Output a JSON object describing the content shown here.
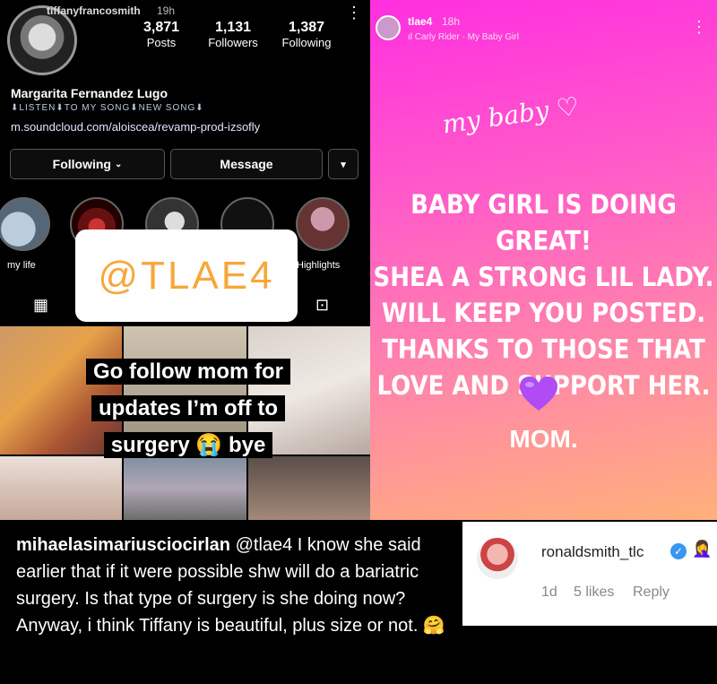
{
  "profile": {
    "username": "tiffanyfrancosmith",
    "time": "19h",
    "stats": [
      {
        "value": "3,871",
        "label": "Posts"
      },
      {
        "value": "1,131",
        "label": "Followers"
      },
      {
        "value": "1,387",
        "label": "Following"
      }
    ],
    "full_name": "Margarita Fernandez Lugo",
    "bio": "⬇LISTEN⬇TO MY SONG⬇NEW SONG⬇",
    "link": "m.soundcloud.com/aloiscea/revamp-prod-izsofly",
    "following_button": "Following",
    "message_button": "Message",
    "highlights": [
      {
        "label": "my life"
      },
      {
        "label": ""
      },
      {
        "label": ""
      },
      {
        "label": ""
      },
      {
        "label": "Highlights"
      }
    ]
  },
  "overlay": {
    "sticker_text": "@TLAE4",
    "caption_lines": [
      "Go follow mom for",
      "updates I’m off to",
      "surgery 😭 bye"
    ]
  },
  "story": {
    "username": "tlae4",
    "time": "18h",
    "song": "Carly Rider · My Baby Girl",
    "handwriting": "my baby ♡",
    "message_lines": [
      "BABY GIRL IS DOING GREAT!",
      "SHEA A STRONG LIL LADY.",
      "WILL KEEP YOU POSTED.",
      "THANKS TO THOSE THAT",
      "LOVE AND SUPPORT HER."
    ],
    "signature": "MOM."
  },
  "comments": [
    {
      "username": "mihaelasimariusciocirlan",
      "text": "@tlae4 I know she said earlier that if it were possible shw will do a bariatric surgery. Is that type of surgery is she doing now? Anyway, i think Tiffany is beautiful, plus size or not. 🤗"
    },
    {
      "username": "ronaldsmith_tlc",
      "emoji": "🤦‍♀️",
      "age": "1d",
      "likes": "5 likes",
      "reply": "Reply"
    }
  ],
  "colors": {
    "story_gradient_top": "#ff2fe0",
    "story_gradient_bottom": "#ffb07a",
    "sticker_text": "#f7a73a",
    "verified": "#3897f0"
  }
}
